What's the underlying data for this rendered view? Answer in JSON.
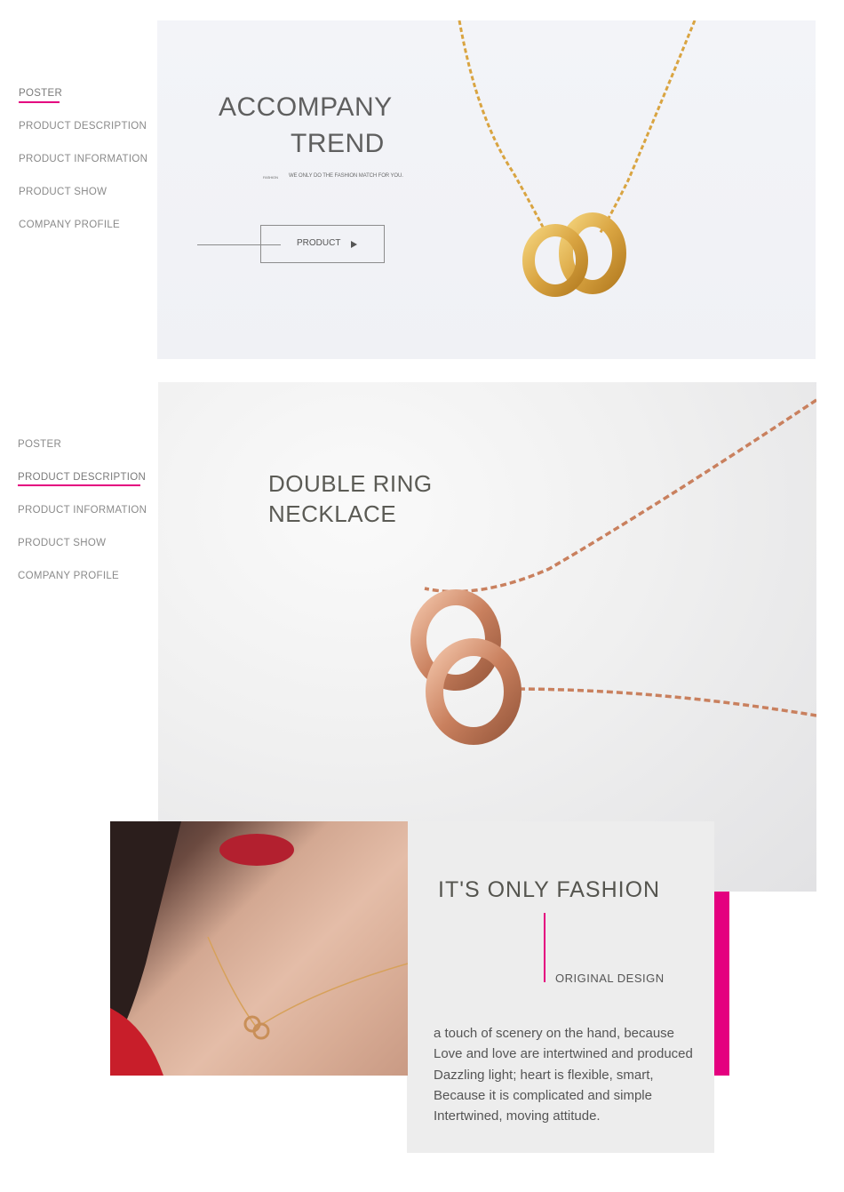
{
  "nav": {
    "items": [
      "POSTER",
      "PRODUCT DESCRIPTION",
      "PRODUCT INFORMATION",
      "PRODUCT SHOW",
      "COMPANY PROFILE"
    ]
  },
  "section1": {
    "title_line1": "ACCOMPANY",
    "title_line2": "TREND",
    "tag_small": "FASHION",
    "tagline": "WE ONLY DO THE FASHION MATCH FOR YOU.",
    "button_label": "PRODUCT"
  },
  "section2": {
    "title_line1": "DOUBLE RING",
    "title_line2": "NECKLACE"
  },
  "section3": {
    "title": "IT'S ONLY FASHION",
    "subtitle": "ORIGINAL DESIGN",
    "body_lines": [
      "a touch of scenery on the hand, because",
      "Love and love are intertwined and produced",
      "Dazzling light; heart is flexible, smart,",
      "Because it is complicated and simple",
      "Intertwined, moving attitude."
    ]
  },
  "colors": {
    "accent": "#e4007f",
    "gold": "#d9a441",
    "rose_gold": "#c9805e"
  },
  "icons": [
    "play-arrow-icon"
  ]
}
